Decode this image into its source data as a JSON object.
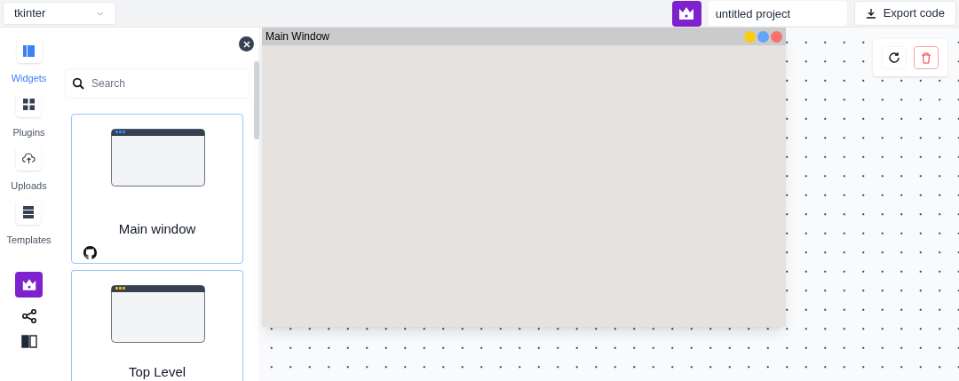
{
  "framework_select": {
    "value": "tkinter"
  },
  "project_name": {
    "value": "untitled project"
  },
  "export_button": {
    "label": "Export code"
  },
  "nav": [
    {
      "label": "Widgets",
      "kind": "widgets",
      "selected": true
    },
    {
      "label": "Plugins",
      "kind": "plugins",
      "selected": false
    },
    {
      "label": "Uploads",
      "kind": "uploads",
      "selected": false
    },
    {
      "label": "Templates",
      "kind": "templates",
      "selected": false
    }
  ],
  "search": {
    "placeholder": "Search"
  },
  "widget_cards": [
    {
      "label": "Main window",
      "color": "#3b82f6",
      "github": true
    },
    {
      "label": "Top Level",
      "color": "#eab308",
      "github": false
    }
  ],
  "canvas_window": {
    "title": "Main Window",
    "buttons": [
      {
        "color": "#facc15"
      },
      {
        "color": "#60a5fa"
      },
      {
        "color": "#f87171"
      }
    ]
  }
}
